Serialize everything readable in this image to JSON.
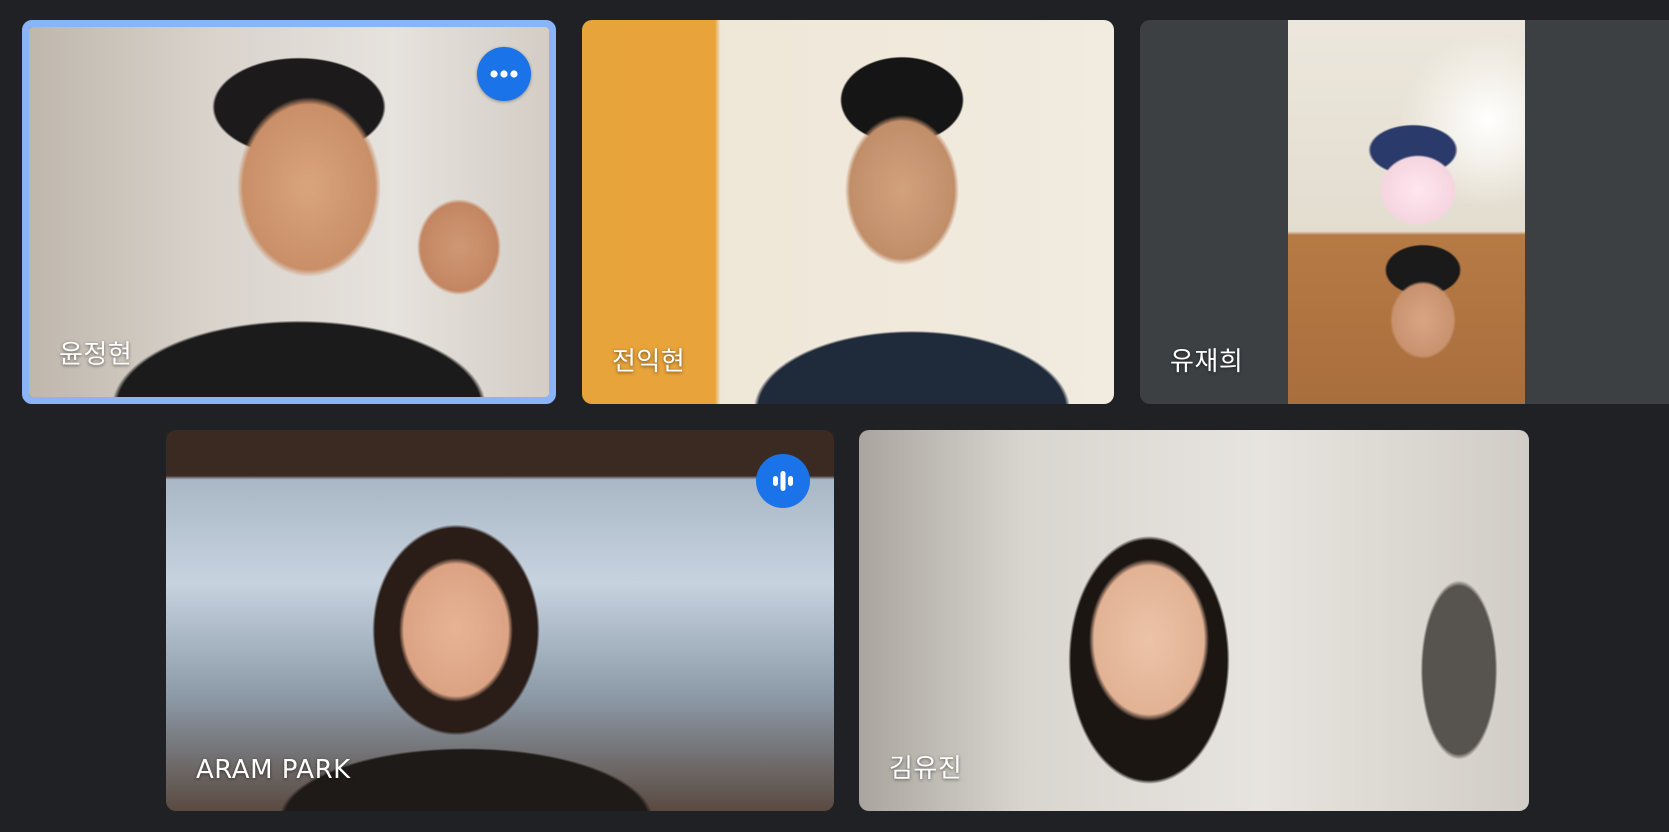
{
  "participants": [
    {
      "name": "윤정현",
      "pinned": true,
      "more_options_icon": "more-horizontal-icon"
    },
    {
      "name": "전익현"
    },
    {
      "name": "유재희"
    },
    {
      "name": "ARAM PARK",
      "speaking_icon": "audio-level-icon"
    },
    {
      "name": "김유진"
    }
  ],
  "colors": {
    "background": "#202124",
    "accent": "#1a73e8",
    "active_border": "#8ab4f8",
    "tile_empty": "#3c4043"
  }
}
